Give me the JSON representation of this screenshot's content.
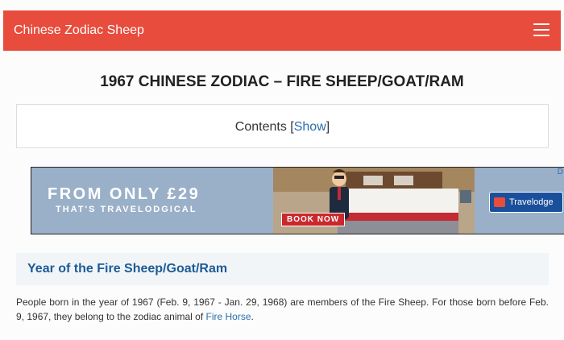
{
  "header": {
    "site_title": "Chinese Zodiac Sheep",
    "menu_icon": "hamburger-menu-icon"
  },
  "article": {
    "title": "1967 CHINESE ZODIAC – FIRE SHEEP/GOAT/RAM",
    "toc": {
      "label": "Contents",
      "open_bracket": "[",
      "toggle": "Show",
      "close_bracket": "]"
    },
    "section_heading": "Year of the Fire Sheep/Goat/Ram",
    "paragraph_text": "People born in the year of 1967 (Feb. 9, 1967 - Jan. 29, 1968) are members of the Fire Sheep. For those born before Feb. 9, 1967, they belong to the zodiac animal of ",
    "paragraph_link": "Fire Horse",
    "paragraph_end": "."
  },
  "ad": {
    "headline": "FROM ONLY £29",
    "subline": "THAT'S TRAVELODGICAL",
    "cta": "BOOK NOW",
    "brand": "Travelodge",
    "adchoice": "D"
  },
  "colors": {
    "header_bg": "#e84c3d",
    "link": "#2a6fad",
    "section_heading": "#1d5b96"
  }
}
